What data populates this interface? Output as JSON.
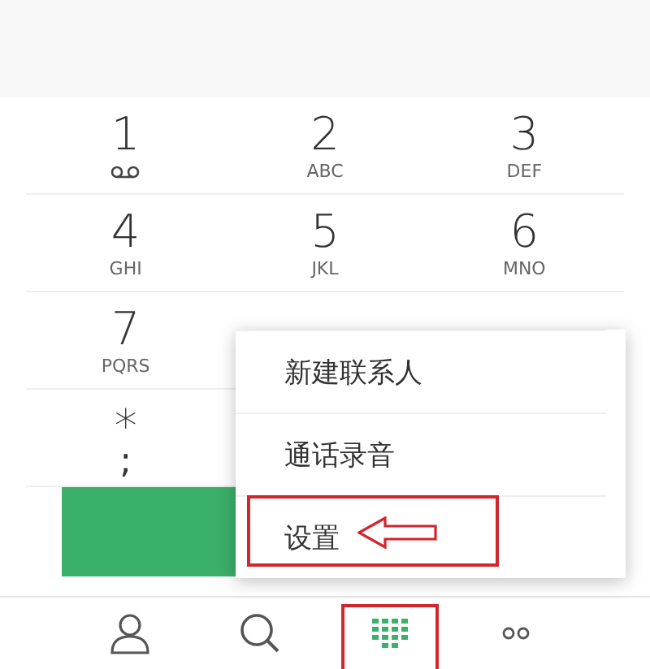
{
  "keypad_rows": [
    [
      {
        "digit": "1",
        "kind": "voicemail"
      },
      {
        "digit": "2",
        "kind": "letters",
        "letters": "ABC"
      },
      {
        "digit": "3",
        "kind": "letters",
        "letters": "DEF"
      }
    ],
    [
      {
        "digit": "4",
        "kind": "letters",
        "letters": "GHI"
      },
      {
        "digit": "5",
        "kind": "letters",
        "letters": "JKL"
      },
      {
        "digit": "6",
        "kind": "letters",
        "letters": "MNO"
      }
    ],
    [
      {
        "digit": "7",
        "kind": "letters",
        "letters": "PQRS"
      }
    ],
    [
      {
        "digit": "*",
        "kind": "letters",
        "letters": ";"
      }
    ]
  ],
  "menu": {
    "items": [
      {
        "label": "新建联系人",
        "highlighted": false
      },
      {
        "label": "通话录音",
        "highlighted": false
      },
      {
        "label": "设置",
        "highlighted": true
      }
    ]
  },
  "nav": [
    {
      "kind": "contacts",
      "selected": false,
      "highlighted": false
    },
    {
      "kind": "search",
      "selected": false,
      "highlighted": false
    },
    {
      "kind": "dialpad",
      "selected": true,
      "highlighted": true
    },
    {
      "kind": "more",
      "selected": false,
      "highlighted": false
    }
  ]
}
